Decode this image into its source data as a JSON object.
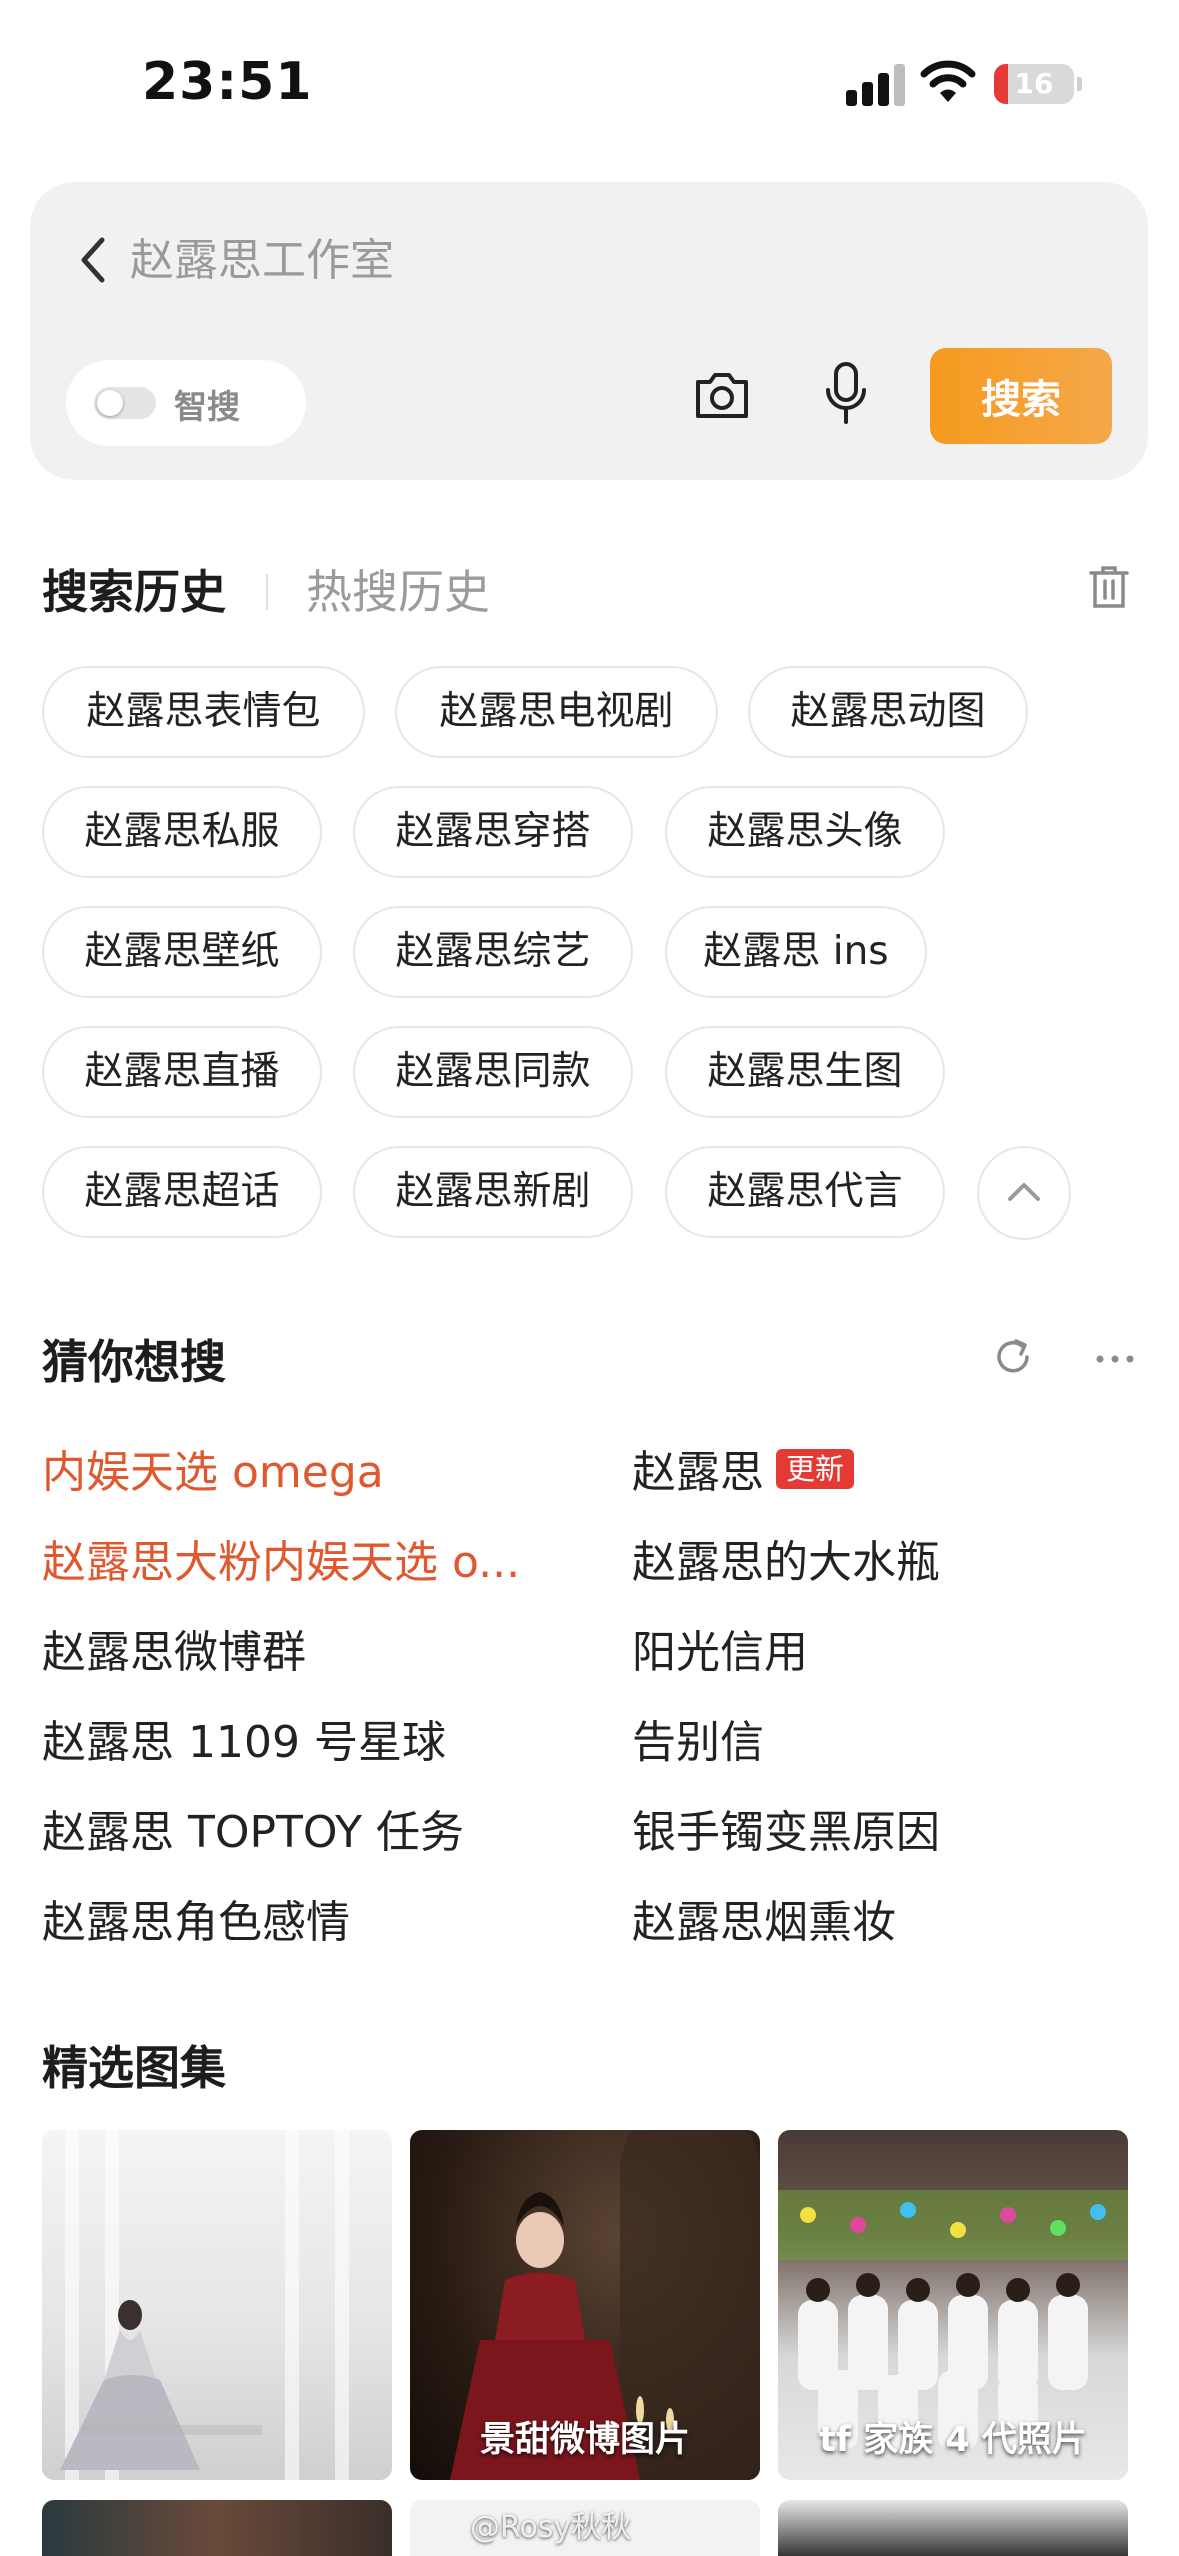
{
  "status_bar": {
    "time": "23:51",
    "battery": "16"
  },
  "search": {
    "placeholder": "赵露思工作室",
    "smart_label": "智搜",
    "button_label": "搜索"
  },
  "history": {
    "tab_history": "搜索历史",
    "tab_hot": "热搜历史",
    "chips": [
      "赵露思表情包",
      "赵露思电视剧",
      "赵露思动图",
      "赵露思私服",
      "赵露思穿搭",
      "赵露思头像",
      "赵露思壁纸",
      "赵露思综艺",
      "赵露思 ins",
      "赵露思直播",
      "赵露思同款",
      "赵露思生图",
      "赵露思超话",
      "赵露思新剧",
      "赵露思代言"
    ]
  },
  "guess": {
    "title": "猜你想搜",
    "left": [
      "内娱天选 omega",
      "赵露思大粉内娱天选 o...",
      "赵露思微博群",
      "赵露思 1109 号星球",
      "赵露思 TOPTOY 任务",
      "赵露思角色感情"
    ],
    "right": [
      "赵露思",
      "赵露思的大水瓶",
      "阳光信用",
      "告别信",
      "银手镯变黑原因",
      "赵露思烟熏妆"
    ],
    "new_badge": "更新",
    "highlight_color": "#e0582e"
  },
  "gallery": {
    "title": "精选图集",
    "cards": [
      "",
      "景甜微博图片",
      "tf 家族 4 代照片"
    ],
    "watermark": "@Rosy秋秋"
  }
}
